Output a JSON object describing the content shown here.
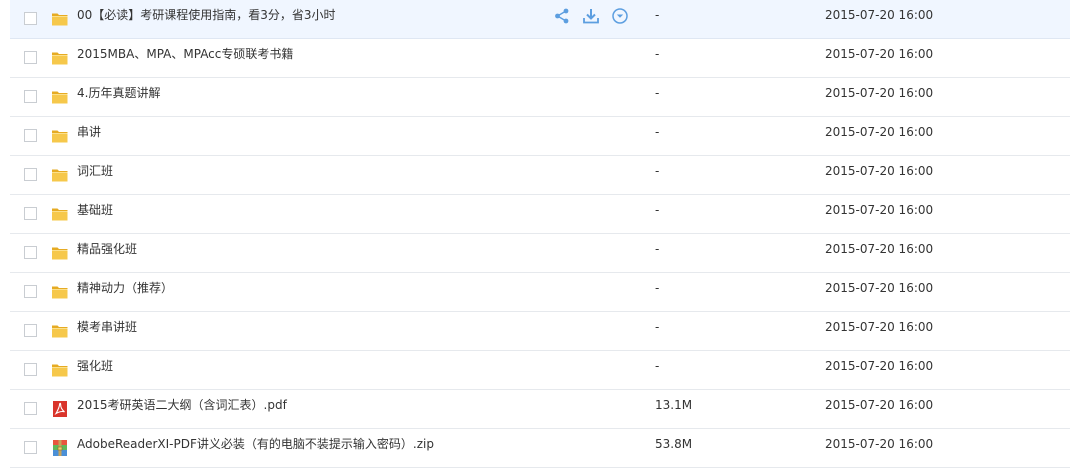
{
  "colors": {
    "folder": "#f6c84b",
    "folder_dark": "#e6ab23",
    "action_icon": "#5c9ee0",
    "pdf_icon": "#d9342b",
    "hover_row": "#f0f6ff"
  },
  "files": [
    {
      "name": "00【必读】考研课程使用指南，看3分，省3小时",
      "size": "-",
      "modified": "2015-07-20 16:00",
      "type": "folder",
      "icon": "folder-icon"
    },
    {
      "name": "2015MBA、MPA、MPAcc专硕联考书籍",
      "size": "-",
      "modified": "2015-07-20 16:00",
      "type": "folder",
      "icon": "folder-icon"
    },
    {
      "name": "4.历年真题讲解",
      "size": "-",
      "modified": "2015-07-20 16:00",
      "type": "folder",
      "icon": "folder-icon"
    },
    {
      "name": "串讲",
      "size": "-",
      "modified": "2015-07-20 16:00",
      "type": "folder",
      "icon": "folder-icon"
    },
    {
      "name": "词汇班",
      "size": "-",
      "modified": "2015-07-20 16:00",
      "type": "folder",
      "icon": "folder-icon"
    },
    {
      "name": "基础班",
      "size": "-",
      "modified": "2015-07-20 16:00",
      "type": "folder",
      "icon": "folder-icon"
    },
    {
      "name": "精品强化班",
      "size": "-",
      "modified": "2015-07-20 16:00",
      "type": "folder",
      "icon": "folder-icon"
    },
    {
      "name": "精神动力（推荐）",
      "size": "-",
      "modified": "2015-07-20 16:00",
      "type": "folder",
      "icon": "folder-icon"
    },
    {
      "name": "模考串讲班",
      "size": "-",
      "modified": "2015-07-20 16:00",
      "type": "folder",
      "icon": "folder-icon"
    },
    {
      "name": "强化班",
      "size": "-",
      "modified": "2015-07-20 16:00",
      "type": "folder",
      "icon": "folder-icon"
    },
    {
      "name": "2015考研英语二大纲（含词汇表）.pdf",
      "size": "13.1M",
      "modified": "2015-07-20 16:00",
      "type": "pdf",
      "icon": "pdf-icon"
    },
    {
      "name": "AdobeReaderXI-PDF讲义必装（有的电脑不装提示输入密码）.zip",
      "size": "53.8M",
      "modified": "2015-07-20 16:00",
      "type": "zip",
      "icon": "zip-icon"
    }
  ],
  "row_actions": {
    "share_icon": "share-icon",
    "download_icon": "download-icon",
    "more_icon": "more-dropdown-icon"
  }
}
